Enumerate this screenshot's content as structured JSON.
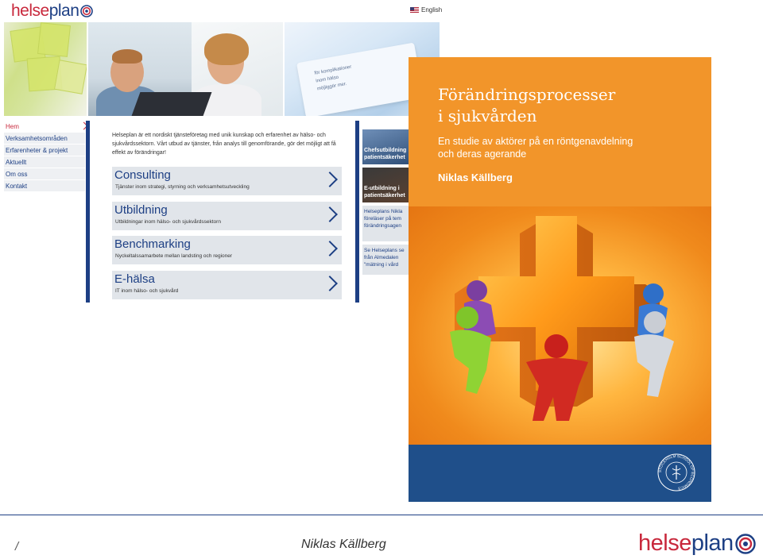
{
  "site": {
    "logo": {
      "part1": "helse",
      "part2": "plan"
    },
    "language_link": "English",
    "nav_items": [
      {
        "label": "Hem",
        "active": true
      },
      {
        "label": "Verksamhetsområden",
        "active": false
      },
      {
        "label": "Erfarenheter & projekt",
        "active": false
      },
      {
        "label": "Aktuellt",
        "active": false
      },
      {
        "label": "Om oss",
        "active": false
      },
      {
        "label": "Kontakt",
        "active": false
      }
    ],
    "intro_text": "Helseplan är ett nordiskt tjänsteföretag med unik kunskap och erfarenhet av hälso- och sjukvårdssektorn. Vårt utbud av tjänster, från analys till genomförande, gör det möjligt att få effekt av förändringar!",
    "services": [
      {
        "title": "Consulting",
        "subtitle": "Tjänster inom strategi, styrning och verksamhetsutveckling"
      },
      {
        "title": "Utbildning",
        "subtitle": "Utbildningar inom hälso- och sjukvårdssektorn"
      },
      {
        "title": "Benchmarking",
        "subtitle": "Nyckeltalssamarbete mellan landsting och regioner"
      },
      {
        "title": "E-hälsa",
        "subtitle": "IT inom hälso- och sjukvård"
      }
    ],
    "right_column": {
      "photo1_caption": [
        "Chefsutbildning",
        "patientsäkerhet"
      ],
      "photo2_caption": [
        "E-utbildning i",
        "patientsäkerhet"
      ],
      "news1": [
        "Helseplans Nikla",
        "föreläser på tem",
        "förändringsagen"
      ],
      "news2": [
        "Se Helseplans se",
        "från Almedalen",
        "\"mätning i vård"
      ]
    },
    "banner_paper_text": [
      "för komplikationer",
      "inom hälso",
      "möjliggör mer."
    ]
  },
  "book": {
    "title_line1": "Förändringsprocesser",
    "title_line2": "i sjukvården",
    "subtitle_line1": "En studie av aktörer på en röntgenavdelning",
    "subtitle_line2": "och deras agerande",
    "author": "Niklas Källberg",
    "seal_text": "STOCKHOLM SCHOOL OF ECONOMICS",
    "colors": {
      "orange": "#f2952a",
      "blue": "#1f4f8a"
    }
  },
  "footer": {
    "slash": "/",
    "presenter": "Niklas Källberg",
    "logo": {
      "part1": "helse",
      "part2": "plan"
    }
  },
  "colors": {
    "brand_red": "#c8283c",
    "brand_blue": "#1d3f84"
  }
}
